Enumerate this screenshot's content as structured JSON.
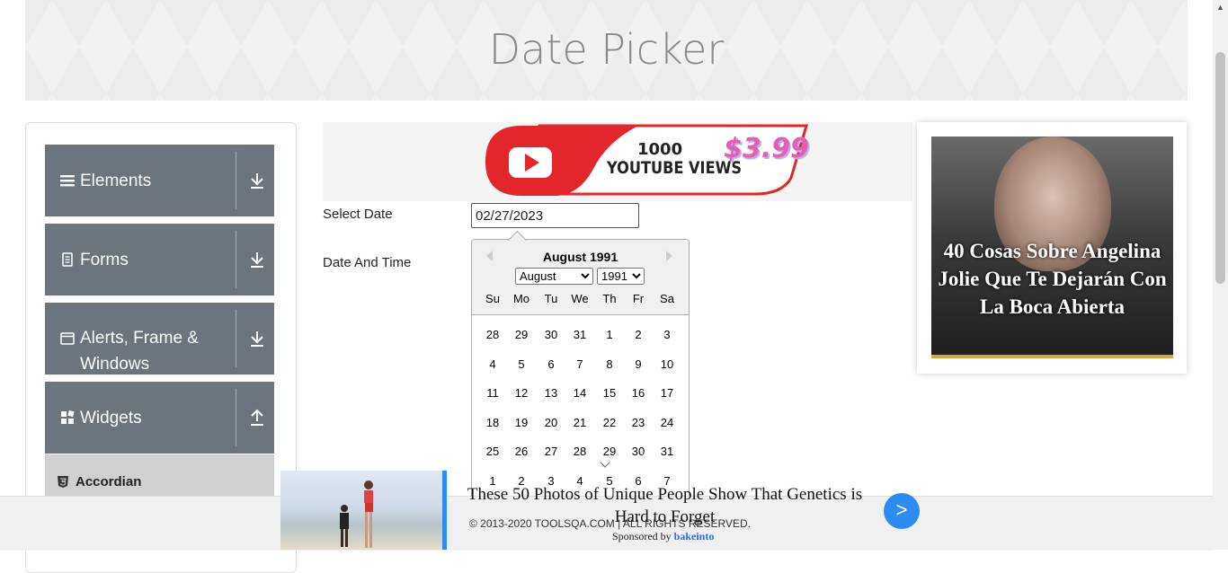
{
  "header": {
    "title": "Date Picker"
  },
  "sidebar": {
    "groups": [
      {
        "label": "Elements",
        "icon": "hamburger-icon",
        "arrow": "download-arrow-icon"
      },
      {
        "label": "Forms",
        "icon": "document-icon",
        "arrow": "download-arrow-icon"
      },
      {
        "label": "Alerts, Frame & Windows",
        "icon": "window-icon",
        "arrow": "download-arrow-icon"
      },
      {
        "label": "Widgets",
        "icon": "widgets-icon",
        "arrow": "upload-arrow-icon"
      }
    ],
    "active_item": {
      "label": "Accordian",
      "icon": "html5-icon"
    }
  },
  "top_ad": {
    "line1": "1000",
    "line2": "YOUTUBE VIEWS",
    "price": "$3.99"
  },
  "form": {
    "select_date_label": "Select Date",
    "select_date_value": "02/27/2023",
    "date_time_label": "Date And Time"
  },
  "datepicker": {
    "title": "August 1991",
    "selected_month": "August",
    "selected_year": "1991",
    "weekdays": [
      "Su",
      "Mo",
      "Tu",
      "We",
      "Th",
      "Fr",
      "Sa"
    ],
    "weeks": [
      [
        "28",
        "29",
        "30",
        "31",
        "1",
        "2",
        "3"
      ],
      [
        "4",
        "5",
        "6",
        "7",
        "8",
        "9",
        "10"
      ],
      [
        "11",
        "12",
        "13",
        "14",
        "15",
        "16",
        "17"
      ],
      [
        "18",
        "19",
        "20",
        "21",
        "22",
        "23",
        "24"
      ],
      [
        "25",
        "26",
        "27",
        "28",
        "29",
        "30",
        "31"
      ],
      [
        "1",
        "2",
        "3",
        "4",
        "5",
        "6",
        "7"
      ]
    ]
  },
  "right_ad": {
    "headline": "40 Cosas Sobre Angelina Jolie Que Te Dejarán Con La Boca Abierta"
  },
  "bottom_ad": {
    "headline": "These 50 Photos of Unique People Show That Genetics is Hard to Forget",
    "sponsor_prefix": "Sponsored by",
    "sponsor_name": "bakeinto",
    "next_label": ">"
  },
  "footer": {
    "text": "© 2013-2020 TOOLSQA.COM | ALL RIGHTS RESERVED."
  },
  "colors": {
    "sidebar_group": "#6c757d",
    "accent_blue": "#2d8cef",
    "youtube_red": "#e3262b",
    "price_pink": "#e35fb5"
  }
}
